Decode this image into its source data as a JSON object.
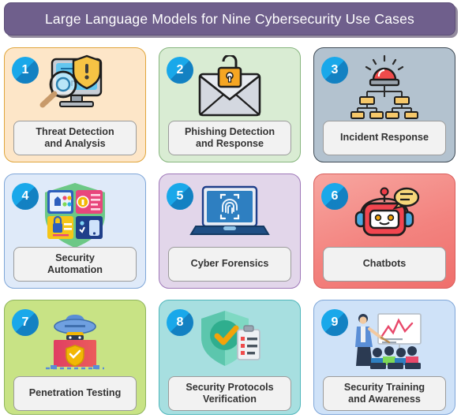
{
  "header": {
    "title": "Large Language Models for Nine Cybersecurity Use Cases",
    "background_color": "#6f5f8c",
    "text_color": "#ffffff"
  },
  "badge_style": {
    "fill_color": "#19a8ea",
    "shadow_color": "#0a4b8c",
    "text_color": "#ffffff"
  },
  "cards": [
    {
      "number": "1",
      "label": "Threat Detection and Analysis",
      "label_line1": "Threat Detection",
      "label_line2": "and Analysis",
      "icon": "monitor-magnifier-shield-icon",
      "background_color": "#fde6c8",
      "border_color": "#e0a63c"
    },
    {
      "number": "2",
      "label": "Phishing Detection and Response",
      "label_line1": "Phishing Detection",
      "label_line2": "and Response",
      "icon": "envelope-padlock-icon",
      "background_color": "#d9ecd3",
      "border_color": "#86b57e"
    },
    {
      "number": "3",
      "label": "Incident Response",
      "label_line1": "Incident Response",
      "label_line2": "",
      "icon": "siren-hierarchy-icon",
      "background_color": "#b3c2cf",
      "border_color": "#3e4a55"
    },
    {
      "number": "4",
      "label": "Security Automation",
      "label_line1": "Security",
      "label_line2": "Automation",
      "icon": "shield-app-panels-icon",
      "background_color": "#dfeaf9",
      "border_color": "#7fa6d8"
    },
    {
      "number": "5",
      "label": "Cyber Forensics",
      "label_line1": "Cyber Forensics",
      "label_line2": "",
      "icon": "laptop-fingerprint-icon",
      "background_color": "#e2d6ea",
      "border_color": "#9e77b8"
    },
    {
      "number": "6",
      "label": "Chatbots",
      "label_line1": "Chatbots",
      "label_line2": "",
      "icon": "robot-chat-bubble-icon",
      "background_color": "#f3837f",
      "border_color": "#d95d5b"
    },
    {
      "number": "7",
      "label": "Penetration Testing",
      "label_line1": "Penetration Testing",
      "label_line2": "",
      "icon": "hacker-hat-laptop-shield-icon",
      "background_color": "#c8e385",
      "border_color": "#8fb55c"
    },
    {
      "number": "8",
      "label": "Security Protocols Verification",
      "label_line1": "Security Protocols",
      "label_line2": "Verification",
      "icon": "shield-check-clipboard-icon",
      "background_color": "#a7dfe0",
      "border_color": "#4fb6bb"
    },
    {
      "number": "9",
      "label": "Security Training and Awareness",
      "label_line1": "Security Training",
      "label_line2": "and Awareness",
      "icon": "presenter-audience-whiteboard-icon",
      "background_color": "#cfe2f8",
      "border_color": "#7fa6d8"
    }
  ]
}
